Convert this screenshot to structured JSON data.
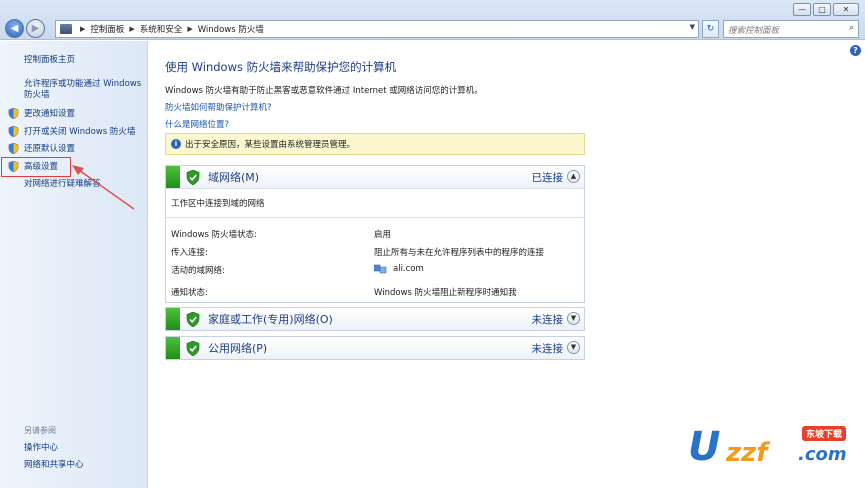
{
  "window": {
    "controls": [
      "—",
      "□",
      "✕"
    ]
  },
  "nav": {
    "breadcrumb": [
      "控制面板",
      "系统和安全",
      "Windows 防火墙"
    ],
    "search_placeholder": "搜索控制面板"
  },
  "sidebar": {
    "home": "控制面板主页",
    "allow_app": "允许程序或功能通过 Windows 防火墙",
    "items": [
      {
        "label": "更改通知设置"
      },
      {
        "label": "打开或关闭 Windows 防火墙"
      },
      {
        "label": "还原默认设置"
      },
      {
        "label": "高级设置"
      }
    ],
    "troubleshoot": "对网络进行疑难解答",
    "see_also_title": "另请参阅",
    "see_also": [
      "操作中心",
      "网络和共享中心"
    ]
  },
  "main": {
    "title": "使用 Windows 防火墙来帮助保护您的计算机",
    "description": "Windows 防火墙有助于防止黑客或恶意软件通过 Internet 或网络访问您的计算机。",
    "link1": "防火墙如何帮助保护计算机?",
    "link2": "什么是网络位置?",
    "info": "出于安全原因，某些设置由系统管理员管理。",
    "domain": {
      "title": "域网络(M)",
      "status": "已连接",
      "subtitle": "工作区中连接到域的网络",
      "rows": [
        {
          "key": "Windows 防火墙状态:",
          "value": "启用"
        },
        {
          "key": "传入连接:",
          "value": "阻止所有与未在允许程序列表中的程序的连接"
        },
        {
          "key": "活动的域网络:",
          "value": "ali.com"
        },
        {
          "key": "通知状态:",
          "value": "Windows 防火墙阻止新程序时通知我"
        }
      ]
    },
    "home_network": {
      "title": "家庭或工作(专用)网络(O)",
      "status": "未连接"
    },
    "public_network": {
      "title": "公用网络(P)",
      "status": "未连接"
    }
  },
  "watermark": {
    "u": "U",
    "rest": "zzf",
    "com": ".com",
    "tag": "东坡下载"
  }
}
